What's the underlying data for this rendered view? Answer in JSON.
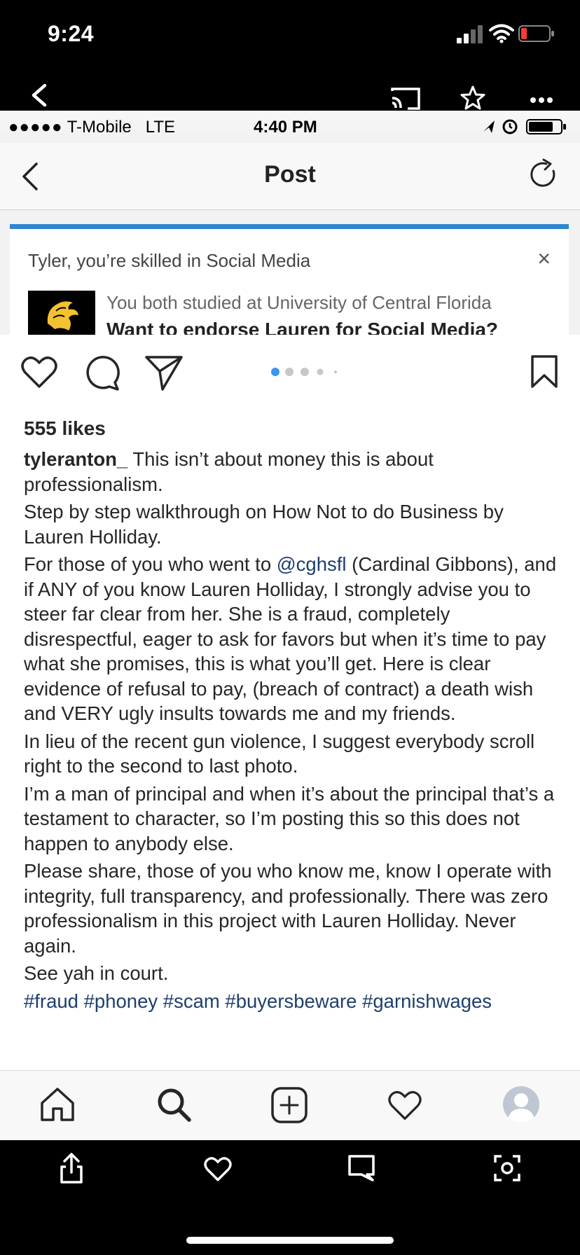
{
  "outer_status": {
    "time": "9:24"
  },
  "viewer_toolbar": {
    "back_icon": "chevron-left-icon",
    "cast_icon": "cast-icon",
    "star_icon": "star-icon",
    "more_icon": "more-icon"
  },
  "inner_status": {
    "dots": "●●●●●",
    "carrier": "T-Mobile",
    "network": "LTE",
    "time": "4:40 PM"
  },
  "nav": {
    "title": "Post"
  },
  "embed": {
    "headline": "Tyler, you’re skilled in Social Media",
    "close": "×",
    "subtitle": "You both studied at University of Central Florida",
    "question": "Want to endorse Lauren for Social Media?"
  },
  "post": {
    "likes": "555 likes",
    "username": "tyleranton_",
    "caption_first": " This isn’t about money this is about professionalism.",
    "p2": "Step by step walkthrough on How Not to do Business by Lauren Holliday.",
    "p3_pre": "For those of you who went to ",
    "p3_mention": "@cghsfl",
    "p3_post": " (Cardinal Gibbons), and if ANY of you know Lauren Holliday, I strongly advise you to steer far clear from her. She is a fraud, completely disrespectful, eager to ask for favors but when it’s time to pay what she promises, this is what you’ll get. Here is clear evidence of refusal to pay, (breach of contract) a death wish and VERY ugly insults towards me and my friends.",
    "p4": "In lieu of the recent gun violence, I suggest everybody scroll right to the second to last photo.",
    "p5": "I’m a man of principal and when it’s about the principal that’s a testament to character, so I’m posting this so this does not happen to anybody else.",
    "p6": "Please share, those of you who know me, know I operate with integrity, full transparency, and professionally. There was zero professionalism in this project with Lauren Holliday. Never again.",
    "p7": "See yah in court.",
    "hashtags": "#fraud #phoney #scam #buyersbeware #garnishwages"
  },
  "colors": {
    "accent_blue": "#2f86d1",
    "link": "#1f3e6e",
    "carousel_active": "#3897f0"
  }
}
